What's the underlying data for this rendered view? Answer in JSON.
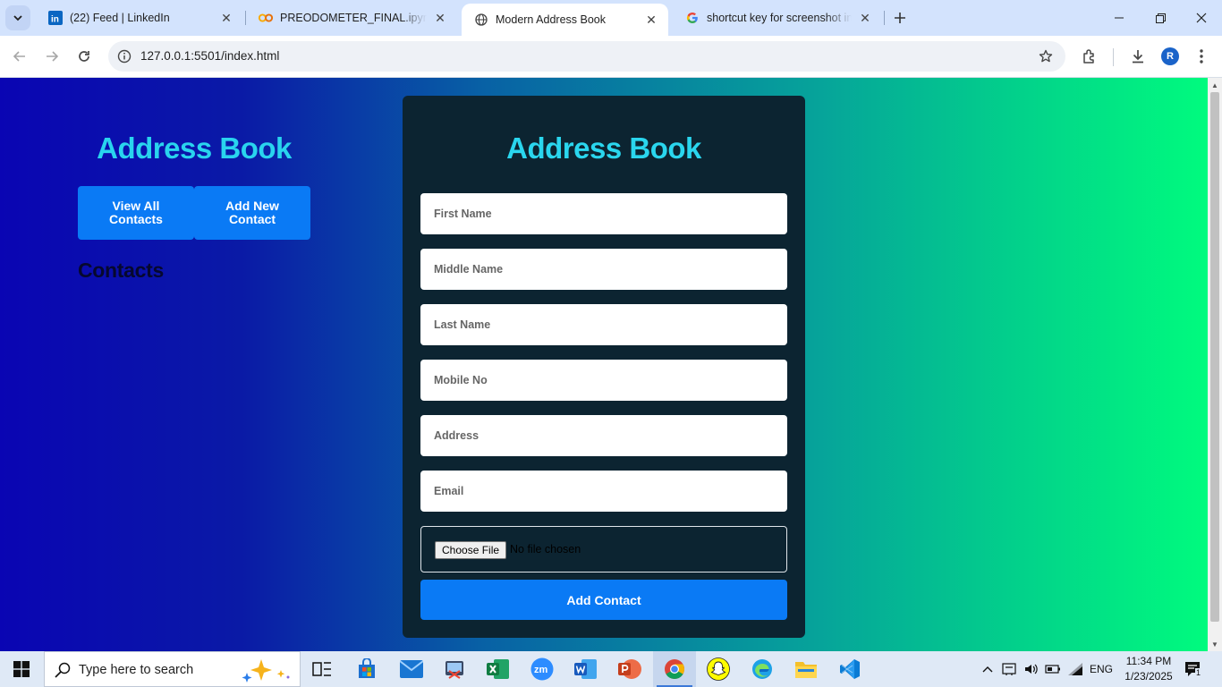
{
  "browser": {
    "tabs": [
      {
        "title": "(22) Feed | LinkedIn",
        "icon": "linkedin-icon",
        "active": false
      },
      {
        "title": "PREODOMETER_FINAL.ipynb - C",
        "icon": "colab-icon",
        "active": false
      },
      {
        "title": "Modern Address Book",
        "icon": "globe-icon",
        "active": true
      },
      {
        "title": "shortcut key for screenshot in w",
        "icon": "google-icon",
        "active": false
      }
    ],
    "url": "127.0.0.1:5501/index.html",
    "profile_initial": "R"
  },
  "page": {
    "sidebar": {
      "title": "Address Book",
      "view_all_label": "View All Contacts",
      "add_new_label": "Add New Contact",
      "contacts_heading": "Contacts"
    },
    "form": {
      "title": "Address Book",
      "fields": {
        "first_name": "First Name",
        "middle_name": "Middle Name",
        "last_name": "Last Name",
        "mobile": "Mobile No",
        "address": "Address",
        "email": "Email"
      },
      "file_button": "Choose File",
      "file_status": "No file chosen",
      "submit_label": "Add Contact"
    },
    "colors": {
      "accent_button": "#0a7af5",
      "title_cyan": "#2ad6ee",
      "card_bg": "#0c2431"
    }
  },
  "taskbar": {
    "search_placeholder": "Type here to search",
    "language": "ENG",
    "time": "11:34 PM",
    "date": "1/23/2025",
    "notification_count": "1"
  }
}
